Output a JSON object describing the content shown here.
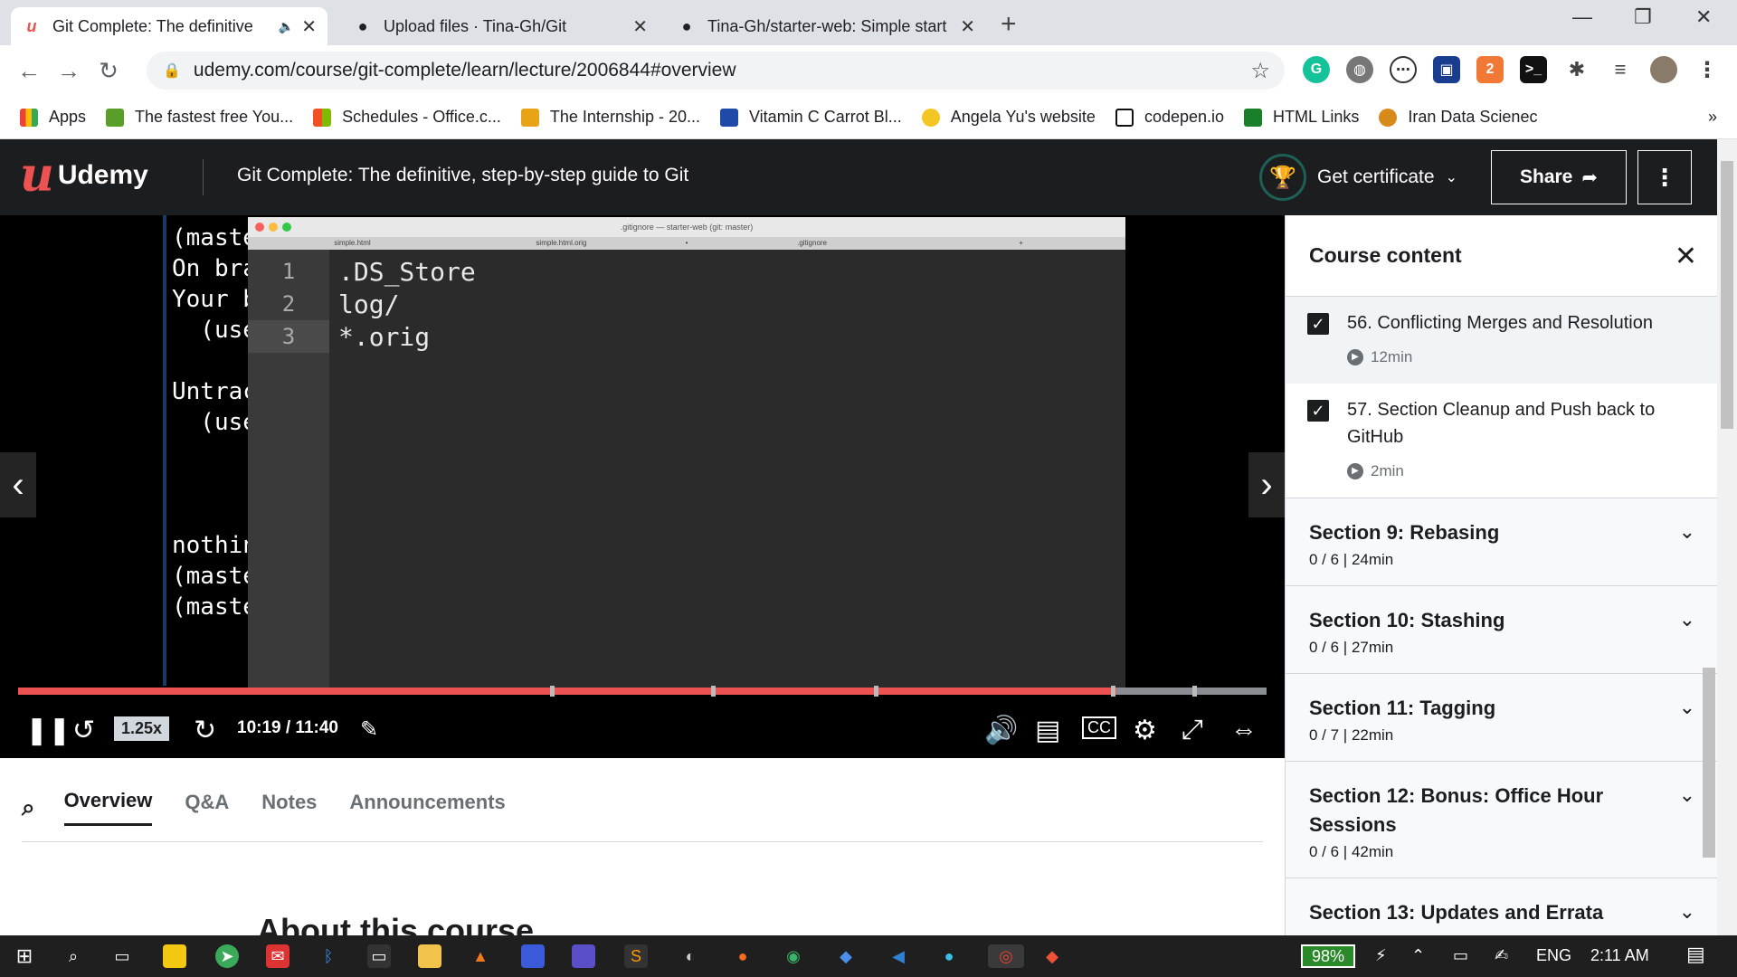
{
  "browser": {
    "tabs": [
      {
        "title": "Git Complete: The definitive",
        "active": true
      },
      {
        "title": "Upload files · Tina-Gh/Git",
        "active": false
      },
      {
        "title": "Tina-Gh/starter-web: Simple start",
        "active": false
      }
    ],
    "url": "udemy.com/course/git-complete/learn/lecture/2006844#overview",
    "bookmarks": [
      "Apps",
      "The fastest free You...",
      "Schedules - Office.c...",
      "The Internship - 20...",
      "Vitamin C Carrot Bl...",
      "Angela Yu's website",
      "codepen.io",
      "HTML Links",
      "Iran Data Scienec"
    ],
    "bookmarks_more": "»"
  },
  "udemy": {
    "logo_text": "Udemy",
    "course_title": "Git Complete: The definitive, step-by-step guide to Git",
    "certificate_label": "Get certificate",
    "share_label": "Share"
  },
  "video": {
    "terminal_lines": [
      "(maste",
      "On bra",
      "Your b",
      "  (use",
      "",
      "Untrac",
      "  (use",
      "",
      "",
      "",
      "nothin",
      "(maste",
      "(maste"
    ],
    "editor_window_title": ".gitignore — starter-web (git: master)",
    "editor_tabs": [
      "simple.html",
      "simple.html.orig",
      "•",
      ".gitignore",
      "+"
    ],
    "code_lines": [
      {
        "n": "1",
        "text": ".DS_Store"
      },
      {
        "n": "2",
        "text": "log/"
      },
      {
        "n": "3",
        "text": "*.orig"
      }
    ],
    "progress": 0.88,
    "speed": "1.25x",
    "time": "10:19 / 11:40"
  },
  "sidebar": {
    "title": "Course content",
    "lectures": [
      {
        "title": "56. Conflicting Merges and Resolution",
        "duration": "12min",
        "checked": true,
        "active": true
      },
      {
        "title": "57. Section Cleanup and Push back to GitHub",
        "duration": "2min",
        "checked": true,
        "active": false
      }
    ],
    "sections": [
      {
        "title": "Section 9: Rebasing",
        "meta": "0 / 6 | 24min"
      },
      {
        "title": "Section 10: Stashing",
        "meta": "0 / 6 | 27min"
      },
      {
        "title": "Section 11: Tagging",
        "meta": "0 / 7 | 22min"
      },
      {
        "title": "Section 12: Bonus: Office Hour Sessions",
        "meta": "0 / 6 | 42min"
      },
      {
        "title": "Section 13: Updates and Errata",
        "meta": ""
      }
    ]
  },
  "page": {
    "tabs": [
      "Overview",
      "Q&A",
      "Notes",
      "Announcements"
    ],
    "about_heading": "About this course"
  },
  "taskbar": {
    "battery": "98%",
    "language": "ENG",
    "clock": "2:11 AM"
  },
  "colors": {
    "udemy_red": "#ec5252",
    "header_dark": "#1c1d1f",
    "cert_green": "#1e6055"
  }
}
